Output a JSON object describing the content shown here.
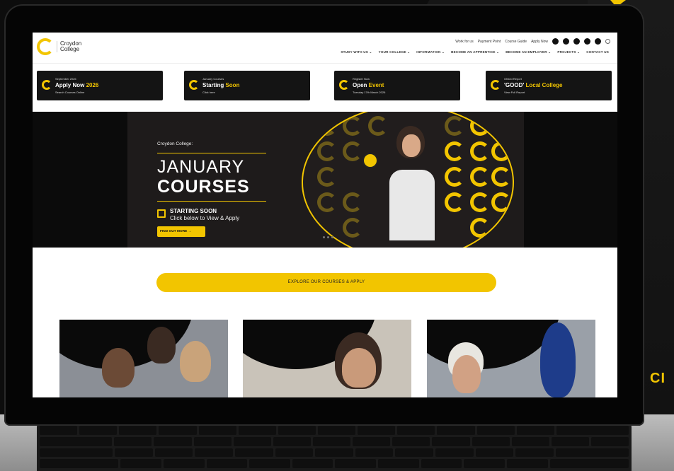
{
  "college": {
    "name_line1": "Croydon",
    "name_line2": "College"
  },
  "toplinks": [
    "Work for us",
    "Payment Point",
    "Course Guide",
    "Apply Now"
  ],
  "social_icons": [
    "facebook-icon",
    "instagram-icon",
    "youtube-icon",
    "linkedin-icon",
    "tiktok-icon"
  ],
  "nav": [
    "STUDY WITH US ⌄",
    "YOUR COLLEGE ⌄",
    "INFORMATION ⌄",
    "BECOME AN APPRENTICE ⌄",
    "BECOME AN EMPLOYER ⌄",
    "PROJECTS ⌄",
    "CONTACT US"
  ],
  "promos": [
    {
      "small": "September 2026",
      "big_a": "Apply Now ",
      "big_b": "2026",
      "sub": "Search Courses Online"
    },
    {
      "small": "January Courses",
      "big_a": "Starting ",
      "big_b": "Soon",
      "sub": "Click here"
    },
    {
      "small": "Register Now",
      "big_a": "Open ",
      "big_b": "Event",
      "sub": "Tuesday 17th March 2026"
    },
    {
      "small": "Ofsted Report",
      "big_a": "'GOOD' ",
      "big_b": "Local College",
      "sub": "View Full Report"
    }
  ],
  "hero": {
    "kicker": "Croydon College:",
    "title1": "JANUARY",
    "title2": "COURSES",
    "soon": "STARTING SOON",
    "click": "Click below to View & Apply",
    "button": "FIND OUT MORE →"
  },
  "explore": "EXPLORE OUR COURSES & APPLY",
  "side_text": "CI",
  "colors": {
    "accent": "#f2c500",
    "dark": "#141414"
  }
}
